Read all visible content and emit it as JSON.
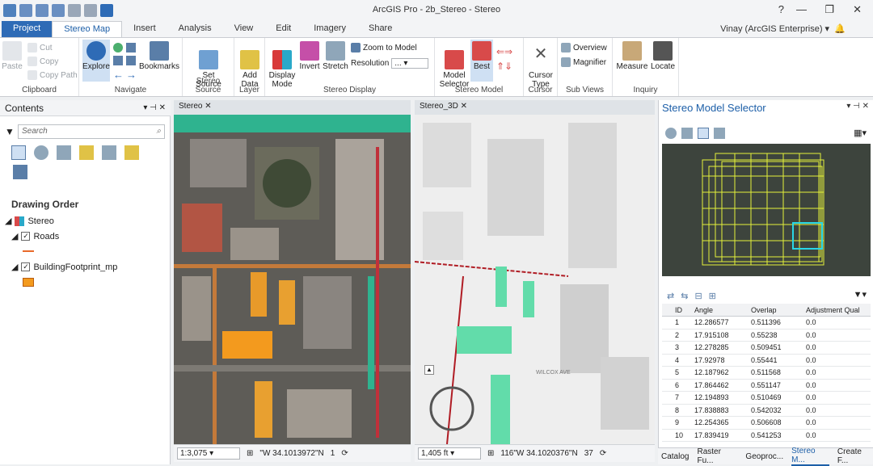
{
  "app": {
    "title": "ArcGIS Pro - 2b_Stereo - Stereo",
    "user": "Vinay (ArcGIS Enterprise)"
  },
  "tabs": [
    "Project",
    "Stereo Map",
    "Insert",
    "Analysis",
    "View",
    "Edit",
    "Imagery",
    "Share"
  ],
  "ribbon": {
    "clipboard": {
      "label": "Clipboard",
      "paste": "Paste",
      "cut": "Cut",
      "copy": "Copy",
      "copy_path": "Copy Path"
    },
    "navigate": {
      "label": "Navigate",
      "explore": "Explore",
      "bookmarks": "Bookmarks"
    },
    "stereo_source": {
      "label": "Stereo Source",
      "set_source": "Set\nSource"
    },
    "layer": {
      "label": "Layer",
      "add_data": "Add\nData"
    },
    "stereo_display": {
      "label": "Stereo Display",
      "display_mode": "Display\nMode",
      "invert": "Invert",
      "stretch": "Stretch",
      "zoom_to_model": "Zoom to Model",
      "resolution": "Resolution",
      "resolution_value": "..."
    },
    "stereo_model": {
      "label": "Stereo Model",
      "model_selector": "Model\nSelector",
      "best": "Best"
    },
    "cursor": {
      "label": "Cursor",
      "cursor_type": "Cursor\nType"
    },
    "sub_views": {
      "label": "Sub Views",
      "overview": "Overview",
      "magnifier": "Magnifier"
    },
    "inquiry": {
      "label": "Inquiry",
      "measure": "Measure",
      "locate": "Locate"
    }
  },
  "contents": {
    "title": "Contents",
    "search_placeholder": "Search",
    "drawing_order": "Drawing Order",
    "layers": [
      "Stereo",
      "Roads",
      "BuildingFootprint_mp"
    ]
  },
  "map1": {
    "tab": "Stereo",
    "scale": "1:3,075",
    "coords": "\"W 34.1013972\"N",
    "count": "1"
  },
  "map2": {
    "tab": "Stereo_3D",
    "scale": "1,405 ft",
    "coords": "116\"W 34.1020376\"N",
    "count": "37",
    "street1": "WILCOX AVE"
  },
  "selector": {
    "title": "Stereo Model Selector",
    "columns": [
      "ID",
      "Angle",
      "Overlap",
      "Adjustment Qual"
    ],
    "rows": [
      [
        "1",
        "12.286577",
        "0.511396",
        "0.0"
      ],
      [
        "2",
        "17.915108",
        "0.55238",
        "0.0"
      ],
      [
        "3",
        "12.278285",
        "0.509451",
        "0.0"
      ],
      [
        "4",
        "17.92978",
        "0.55441",
        "0.0"
      ],
      [
        "5",
        "12.187962",
        "0.511568",
        "0.0"
      ],
      [
        "6",
        "17.864462",
        "0.551147",
        "0.0"
      ],
      [
        "7",
        "12.194893",
        "0.510469",
        "0.0"
      ],
      [
        "8",
        "17.838883",
        "0.542032",
        "0.0"
      ],
      [
        "9",
        "12.254365",
        "0.506608",
        "0.0"
      ],
      [
        "10",
        "17.839419",
        "0.541253",
        "0.0"
      ]
    ]
  },
  "bottom_tabs": [
    "Catalog",
    "Raster Fu...",
    "Geoproc...",
    "Stereo M...",
    "Create F..."
  ]
}
